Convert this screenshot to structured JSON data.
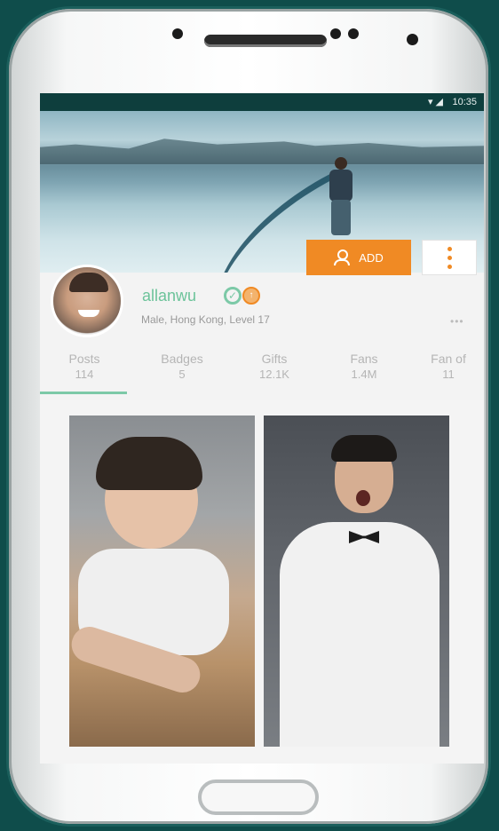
{
  "status_bar": {
    "time": "10:35",
    "icons": "▾ ◢"
  },
  "profile": {
    "add_label": "ADD",
    "username": "allanwu",
    "details": "Male, Hong Kong, Level 17",
    "overflow": "•••"
  },
  "tabs": [
    {
      "label": "Posts",
      "count": "114"
    },
    {
      "label": "Badges",
      "count": "5"
    },
    {
      "label": "Gifts",
      "count": "12.1K"
    },
    {
      "label": "Fans",
      "count": "1.4M"
    },
    {
      "label": "Fan of",
      "count": "11"
    }
  ],
  "selected_tab": "Posts",
  "colors": {
    "accent_green": "#7cc9a7",
    "accent_orange": "#f08a24",
    "background_teal": "#0f4d4b"
  },
  "icons": [
    "person-add-icon",
    "more-vert-icon",
    "verified-icon",
    "level-icon",
    "wifi-icon",
    "signal-icon"
  ]
}
